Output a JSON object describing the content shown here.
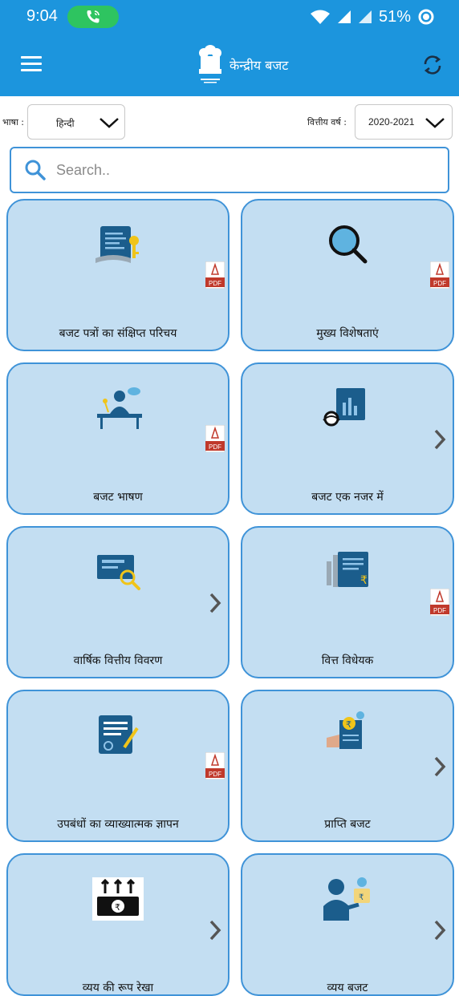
{
  "status": {
    "time": "9:04",
    "battery": "51%"
  },
  "app": {
    "title": "केन्द्रीय बजट"
  },
  "filters": {
    "language_label": "भाषा :",
    "language_value": "हिन्दी",
    "year_label": "वित्तीय वर्ष :",
    "year_value": "2020-2021"
  },
  "search": {
    "placeholder": "Search.."
  },
  "colors": {
    "primary": "#1c95dd",
    "card": "#c3def2",
    "card_border": "#3f93d8",
    "call": "#2ec460"
  },
  "cards": [
    {
      "label": "बजट पत्रों का संक्षिप्त परिचय",
      "icon": "document-key-icon",
      "badge": "pdf"
    },
    {
      "label": "मुख्य विशेषताएं",
      "icon": "magnifier-icon",
      "badge": "pdf"
    },
    {
      "label": "बजट भाषण",
      "icon": "speaker-podium-icon",
      "badge": "pdf"
    },
    {
      "label": "बजट एक नजर में",
      "icon": "chart-document-icon",
      "badge": "chevron"
    },
    {
      "label": "वार्षिक वित्तीय विवरण",
      "icon": "statement-search-icon",
      "badge": "chevron"
    },
    {
      "label": "वित्त विधेयक",
      "icon": "rupee-document-icon",
      "badge": "pdf"
    },
    {
      "label": "उपबंधों का व्याख्यात्मक ज्ञापन",
      "icon": "signed-document-icon",
      "badge": "pdf"
    },
    {
      "label": "प्राप्ति बजट",
      "icon": "rupee-receipt-icon",
      "badge": "chevron"
    },
    {
      "label": "व्यय की रूप रेखा",
      "icon": "rupee-arrows-icon",
      "badge": "chevron"
    },
    {
      "label": "व्यय बजट",
      "icon": "person-rupee-icon",
      "badge": "chevron"
    }
  ],
  "pdf_text": "PDF"
}
